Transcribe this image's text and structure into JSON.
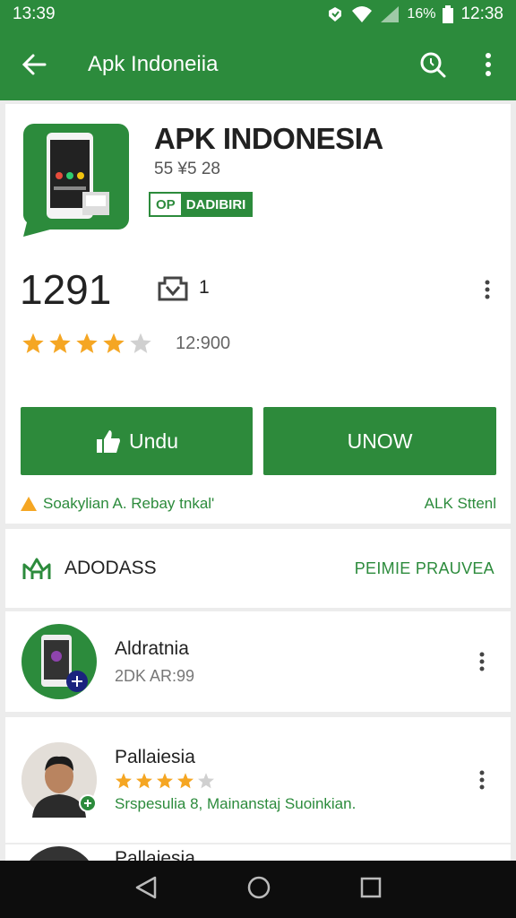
{
  "status_bar": {
    "time_left": "13:39",
    "battery_pct": "16%",
    "time_right": "12:38"
  },
  "app_bar": {
    "title": "Apk Indoneiia",
    "back_icon": "arrow-left-icon",
    "search_icon": "search-icon",
    "more_icon": "more-vert-icon"
  },
  "app": {
    "name": "APK INDONESIA",
    "meta": "55 ¥5 28",
    "badge_left": "OP",
    "badge_right": "DADIBIRI",
    "count": "1291",
    "install_count": "1",
    "rating": 4,
    "rating_count": "12:900"
  },
  "buttons": {
    "primary": "Undu",
    "secondary": "UNOW"
  },
  "notice": {
    "left": "Soakylian A. Rebay tnkal'",
    "right": "ALK Sttenl"
  },
  "section": {
    "label": "ADODASS",
    "link": "PEIMIE PRAUVEA"
  },
  "list": [
    {
      "title": "Aldratnia",
      "subtitle": "2DK AR:99"
    },
    {
      "title": "Pallaiesia",
      "rating": 4,
      "subtitle": "Srspesulia 8, Mainanstaj Suoinkian."
    },
    {
      "title": "Pallaiesia"
    }
  ],
  "colors": {
    "brand_green": "#2c8b3c",
    "star": "#f5a623"
  }
}
